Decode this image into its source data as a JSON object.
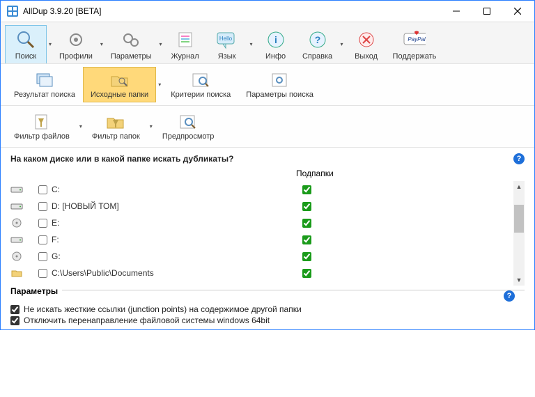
{
  "window": {
    "title": "AllDup 3.9.20 [BETA]"
  },
  "toolbar_main": {
    "search": "Поиск",
    "profiles": "Профили",
    "params": "Параметры",
    "journal": "Журнал",
    "language": "Язык",
    "info": "Инфо",
    "help": "Справка",
    "exit": "Выход",
    "support": "Поддержать",
    "hello_badge": "Hello"
  },
  "toolbar_tabs": {
    "search_result": "Результат поиска",
    "source_folders": "Исходные папки",
    "search_criteria": "Критерии поиска",
    "search_params": "Параметры поиска"
  },
  "toolbar_filters": {
    "file_filter": "Фильтр файлов",
    "folder_filter": "Фильтр папок",
    "preview": "Предпросмотр"
  },
  "content": {
    "heading": "На каком диске или в какой папке искать дубликаты?",
    "subfolders_header": "Подпапки",
    "drives": [
      {
        "label": "C:",
        "checked": false,
        "sub": true,
        "type": "hdd"
      },
      {
        "label": "D: [НОВЫЙ ТОМ]",
        "checked": false,
        "sub": true,
        "type": "hdd"
      },
      {
        "label": "E:",
        "checked": false,
        "sub": true,
        "type": "cd"
      },
      {
        "label": "F:",
        "checked": false,
        "sub": true,
        "type": "hdd"
      },
      {
        "label": "G:",
        "checked": false,
        "sub": true,
        "type": "cd"
      },
      {
        "label": "C:\\Users\\Public\\Documents",
        "checked": false,
        "sub": true,
        "type": "folder"
      }
    ]
  },
  "params": {
    "title": "Параметры",
    "opt_junction": "Не искать жесткие ссылки (junction points) на содержимое другой папки",
    "opt_redirect": "Отключить перенаправление файловой системы windows 64bit",
    "opt_junction_checked": true,
    "opt_redirect_checked": true
  },
  "glyphs": {
    "help": "?",
    "dropdown": "▾",
    "scroll_up": "▲",
    "scroll_down": "▼"
  }
}
